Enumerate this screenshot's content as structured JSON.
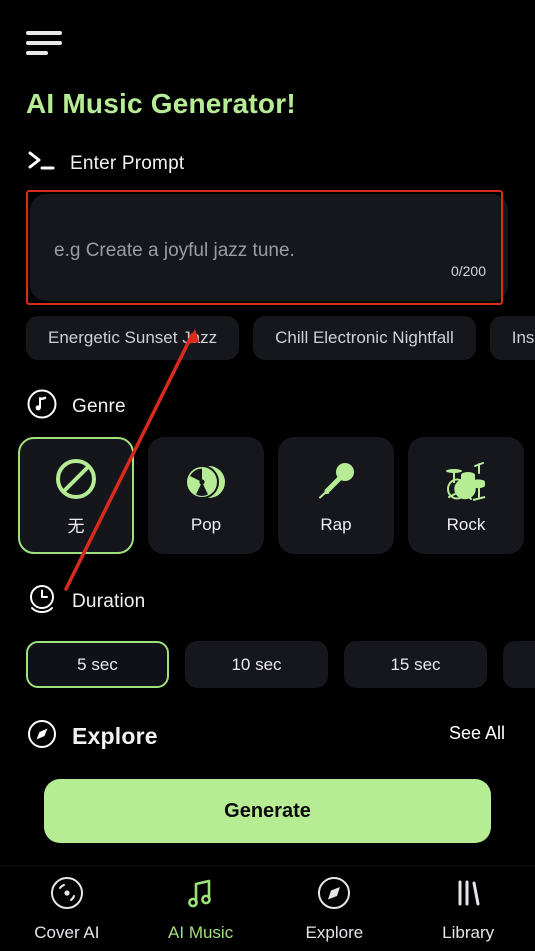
{
  "header": {
    "menu_icon": "hamburger-icon",
    "title": "AI Music Generator!"
  },
  "prompt": {
    "icon": "terminal-prompt-icon",
    "label": "Enter Prompt",
    "placeholder": "e.g Create a joyful jazz tune.",
    "value": "",
    "char_count": "0/200"
  },
  "suggestions": [
    {
      "label": "Energetic Sunset Jazz"
    },
    {
      "label": "Chill Electronic Nightfall"
    },
    {
      "label": "Insp"
    }
  ],
  "genre": {
    "icon": "music-note-circle-icon",
    "label": "Genre",
    "items": [
      {
        "label": "无",
        "icon": "prohibition-icon",
        "selected": true
      },
      {
        "label": "Pop",
        "icon": "vinyl-disc-icon",
        "selected": false
      },
      {
        "label": "Rap",
        "icon": "microphone-icon",
        "selected": false
      },
      {
        "label": "Rock",
        "icon": "drum-kit-icon",
        "selected": false
      }
    ]
  },
  "duration": {
    "icon": "clock-icon",
    "label": "Duration",
    "items": [
      {
        "label": "5 sec",
        "selected": true
      },
      {
        "label": "10 sec",
        "selected": false
      },
      {
        "label": "15 sec",
        "selected": false
      },
      {
        "label": "",
        "selected": false
      }
    ]
  },
  "explore": {
    "icon": "compass-icon",
    "label": "Explore",
    "see_all": "See All"
  },
  "generate": {
    "label": "Generate"
  },
  "bottom_nav": [
    {
      "label": "Cover AI",
      "icon": "vinyl-record-icon",
      "active": false
    },
    {
      "label": "AI Music",
      "icon": "music-notes-icon",
      "active": true
    },
    {
      "label": "Explore",
      "icon": "compass-icon",
      "active": false
    },
    {
      "label": "Library",
      "icon": "books-icon",
      "active": false
    }
  ],
  "colors": {
    "accent": "#b6ec94",
    "accent_border": "#9fe07c",
    "background": "#000000",
    "card": "#16161d",
    "annotation": "#d92b1c"
  }
}
